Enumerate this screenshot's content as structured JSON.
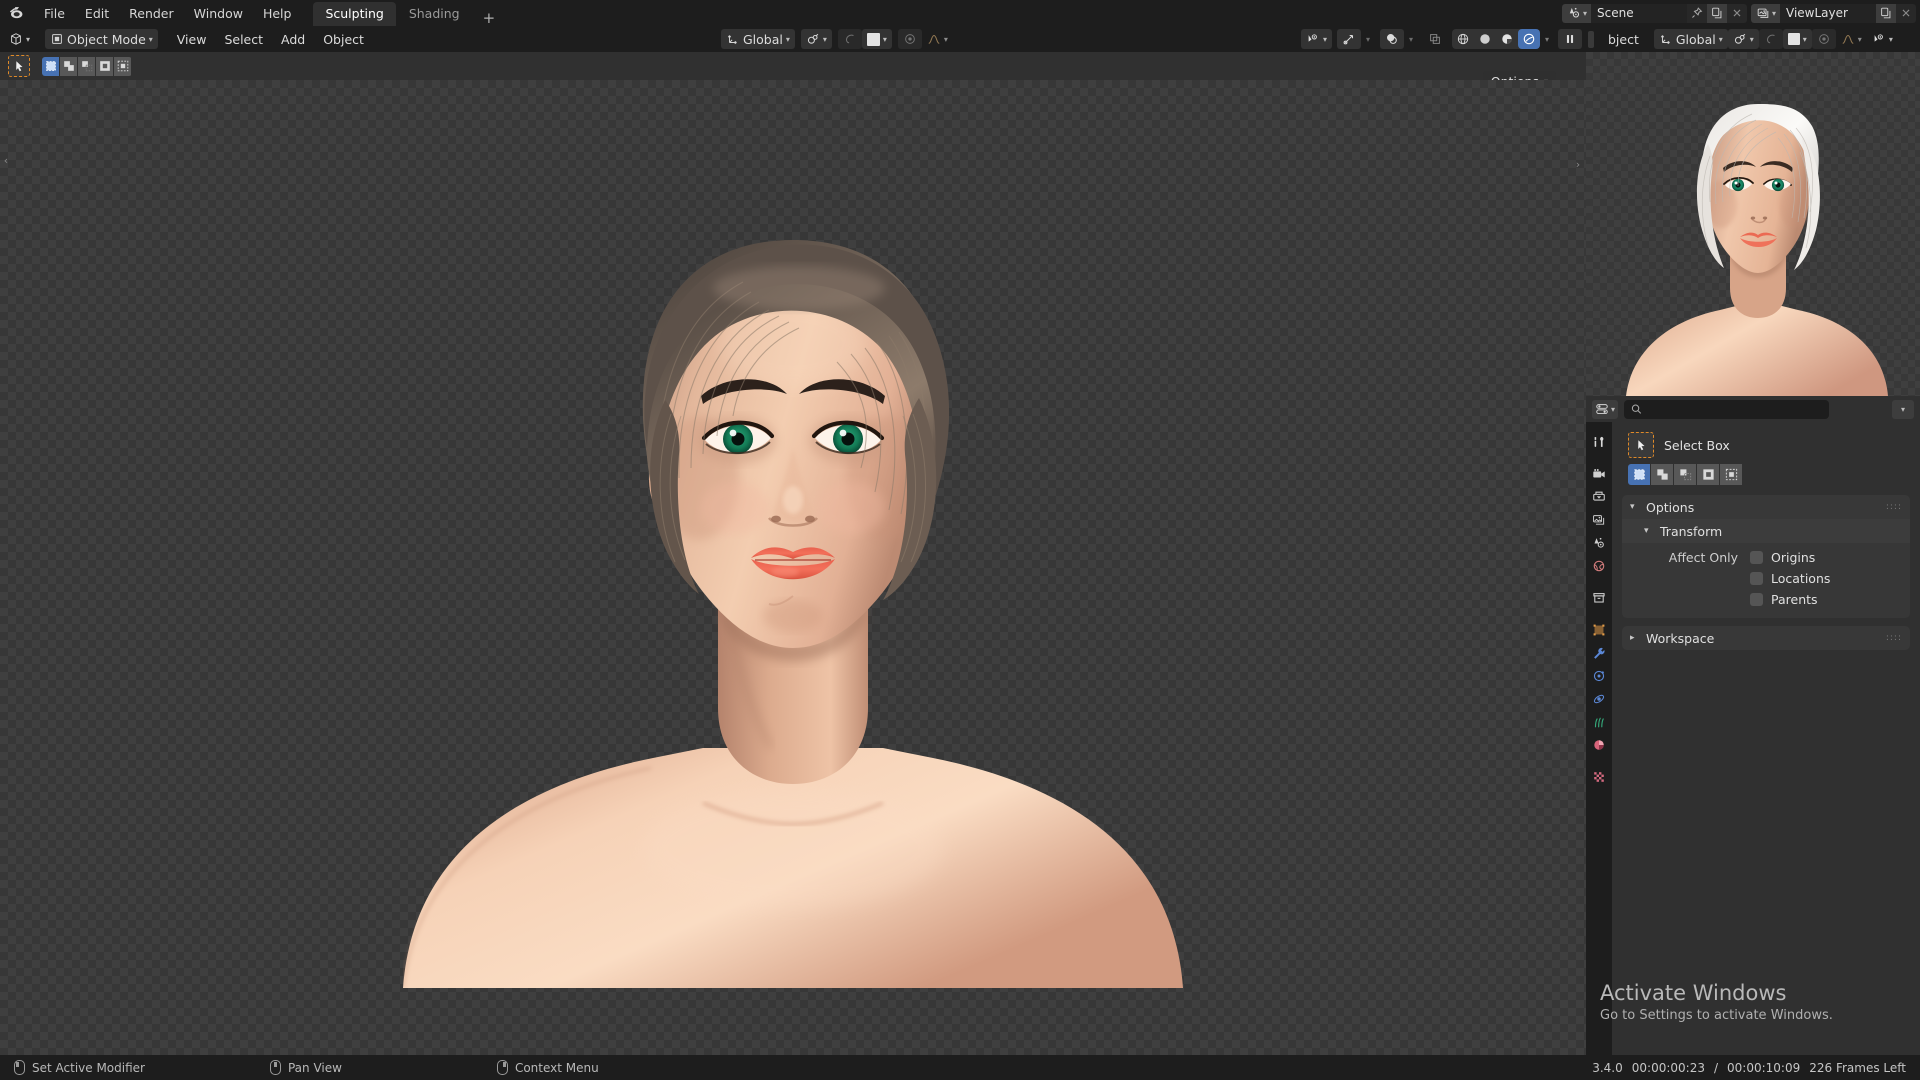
{
  "app": {
    "name": "Blender",
    "version": "3.4.0",
    "logo_icon": "blender-logo-icon"
  },
  "topbar": {
    "menus": [
      "File",
      "Edit",
      "Render",
      "Window",
      "Help"
    ],
    "workspace_tabs": [
      {
        "label": "Sculpting",
        "active": true
      },
      {
        "label": "Shading",
        "active": false
      }
    ],
    "add_workspace_label": "+",
    "scene": {
      "icon": "scene-icon",
      "value": "Scene",
      "pin_icon": "pin-icon",
      "new_icon": "duplicate-icon",
      "unlink_icon": "close-icon"
    },
    "view_layer": {
      "icon": "view-layer-icon",
      "value": "ViewLayer",
      "new_icon": "duplicate-icon",
      "unlink_icon": "close-icon"
    }
  },
  "viewport_header": {
    "editor_type_icon": "editor-type-3dview-icon",
    "mode": {
      "icon": "object-mode-icon",
      "label": "Object Mode"
    },
    "menus": [
      "View",
      "Select",
      "Add",
      "Object"
    ],
    "transform_orientation": {
      "icon": "orientation-icon",
      "label": "Global"
    },
    "snap": {
      "icon": "magnet-icon"
    },
    "proportional_edit": {
      "icon": "proportional-off-icon"
    },
    "pivot_icon": "pivot-icon",
    "falloff_icon": "falloff-smooth-icon",
    "visibility_icon": "visibility-icon",
    "gizmo_icon": "gizmo-icon",
    "overlays_icon": "overlays-icon",
    "xray_icon": "xray-icon",
    "shading_modes": [
      {
        "icon": "shading-wireframe-icon",
        "active": false
      },
      {
        "icon": "shading-solid-icon",
        "active": false
      },
      {
        "icon": "shading-material-icon",
        "active": false
      },
      {
        "icon": "shading-rendered-icon",
        "active": true
      }
    ],
    "pause_icon": "pause-icon"
  },
  "viewport_toolrow": {
    "active_tool_icon": "select-box-cursor-icon",
    "select_modes": [
      {
        "icon": "select-set-icon",
        "active": true
      },
      {
        "icon": "select-extend-icon",
        "active": false
      },
      {
        "icon": "select-subtract-icon",
        "active": false
      },
      {
        "icon": "select-invert-icon",
        "active": false
      },
      {
        "icon": "select-intersect-icon",
        "active": false
      }
    ],
    "options_label": "Options",
    "options_chevron_icon": "chevron-down-icon"
  },
  "second_viewport_header": {
    "object_menu_partial": "bject",
    "transform_orientation": {
      "icon": "orientation-icon",
      "label": "Global"
    },
    "snap_icon": "magnet-icon",
    "proportional_icon": "proportional-off-icon",
    "pivot_icon": "pivot-icon",
    "falloff_icon": "falloff-smooth-icon",
    "visibility_icon": "visibility-icon"
  },
  "preview": {
    "name": "model-preview-render",
    "description": "rendered portrait bust of a female character with white hair"
  },
  "properties": {
    "editor_type_icon": "editor-type-properties-icon",
    "search": {
      "placeholder": "",
      "value": "",
      "icon": "search-icon"
    },
    "filter_icon": "chevron-down-icon",
    "tabs": [
      {
        "name": "tool",
        "icon": "tool-icon",
        "active": true
      },
      {
        "name": "render",
        "icon": "render-camera-icon",
        "active": false
      },
      {
        "name": "output",
        "icon": "output-printer-icon",
        "active": false
      },
      {
        "name": "view-layer",
        "icon": "view-layer-images-icon",
        "active": false
      },
      {
        "name": "scene",
        "icon": "scene-cone-icon",
        "active": false
      },
      {
        "name": "world",
        "icon": "world-globe-icon",
        "active": false
      },
      {
        "name": "collection",
        "icon": "collection-box-icon",
        "active": false
      },
      {
        "name": "object",
        "icon": "object-square-icon",
        "active": false
      },
      {
        "name": "modifiers",
        "icon": "wrench-icon",
        "active": false
      },
      {
        "name": "particles",
        "icon": "particles-icon",
        "active": false
      },
      {
        "name": "physics",
        "icon": "physics-orbit-icon",
        "active": false
      },
      {
        "name": "object-constraints",
        "icon": "grass-icon",
        "active": false
      },
      {
        "name": "material",
        "icon": "material-sphere-icon",
        "active": false
      },
      {
        "name": "texture",
        "icon": "texture-checker-icon",
        "active": false
      }
    ],
    "active_tool": {
      "icon": "select-box-cursor-icon",
      "label": "Select Box"
    },
    "select_modes": [
      {
        "icon": "select-set-icon",
        "active": true
      },
      {
        "icon": "select-extend-icon",
        "active": false
      },
      {
        "icon": "select-subtract-icon",
        "active": false
      },
      {
        "icon": "select-invert-icon",
        "active": false
      },
      {
        "icon": "select-intersect-icon",
        "active": false
      }
    ],
    "panels": [
      {
        "label": "Options",
        "expanded": true,
        "chevron_icon": "chevron-down-icon",
        "grip_icon": "grip-dots-icon",
        "sub": {
          "label": "Transform",
          "expanded": true,
          "chevron_icon": "chevron-down-icon",
          "affect_only_label": "Affect Only",
          "checkboxes": [
            {
              "label": "Origins",
              "checked": false
            },
            {
              "label": "Locations",
              "checked": false
            },
            {
              "label": "Parents",
              "checked": false
            }
          ]
        }
      },
      {
        "label": "Workspace",
        "expanded": false,
        "chevron_icon": "chevron-right-icon",
        "grip_icon": "grip-dots-icon"
      }
    ]
  },
  "watermark": {
    "title": "Activate Windows",
    "subtitle": "Go to Settings to activate Windows."
  },
  "statusbar": {
    "hints": [
      {
        "mouse": "left",
        "label": "Set Active Modifier"
      },
      {
        "mouse": "middle",
        "label": "Pan View"
      },
      {
        "mouse": "right",
        "label": "Context Menu"
      }
    ],
    "version": "3.4.0",
    "time_current": "00:00:00:23",
    "time_separator": "/",
    "time_total": "00:00:10:09",
    "frames_left": "226 Frames Left"
  },
  "colors": {
    "window_bg": "#1d1d1d",
    "editor_bg": "#303030",
    "panel_bg": "#383838",
    "accent_blue": "#4772b3",
    "accent_orange": "#e08a28",
    "text": "#e5e5e5"
  }
}
